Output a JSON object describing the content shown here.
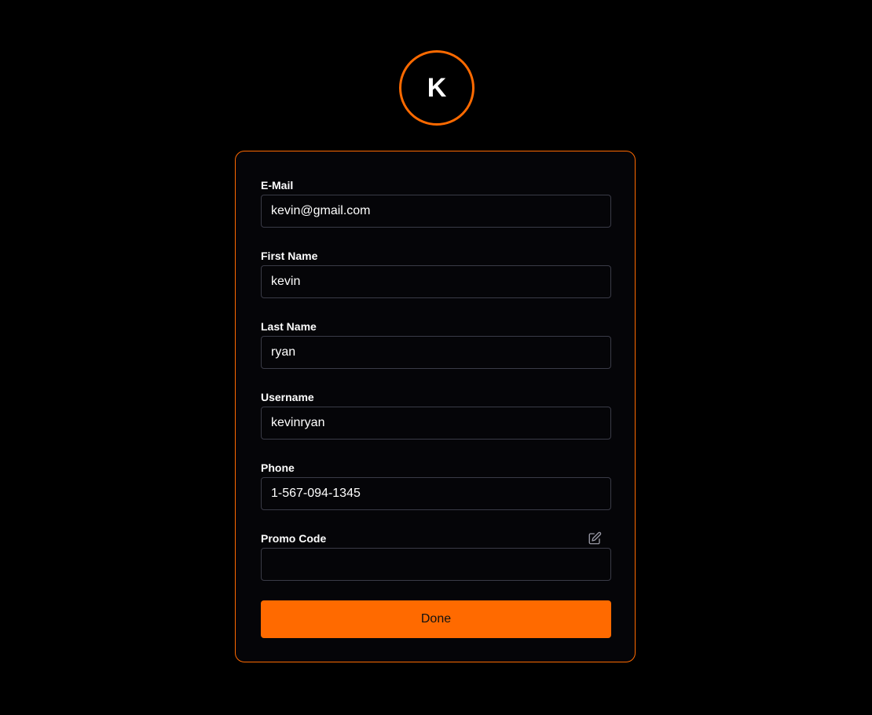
{
  "avatar": {
    "letter": "K"
  },
  "form": {
    "fields": [
      {
        "label": "E-Mail",
        "value": "kevin@gmail.com",
        "placeholder": ""
      },
      {
        "label": "First Name",
        "value": "kevin",
        "placeholder": ""
      },
      {
        "label": "Last Name",
        "value": "ryan",
        "placeholder": ""
      },
      {
        "label": "Username",
        "value": "kevinryan",
        "placeholder": ""
      },
      {
        "label": "Phone",
        "value": "1-567-094-1345",
        "placeholder": ""
      },
      {
        "label": "Promo Code",
        "value": "",
        "placeholder": ""
      }
    ],
    "promo_icon": "edit-pencil-icon",
    "done_label": "Done"
  },
  "colors": {
    "accent": "#ff6a00",
    "background": "#000000",
    "card_background": "#050508",
    "input_border": "#3a3b47",
    "text": "#ffffff"
  }
}
